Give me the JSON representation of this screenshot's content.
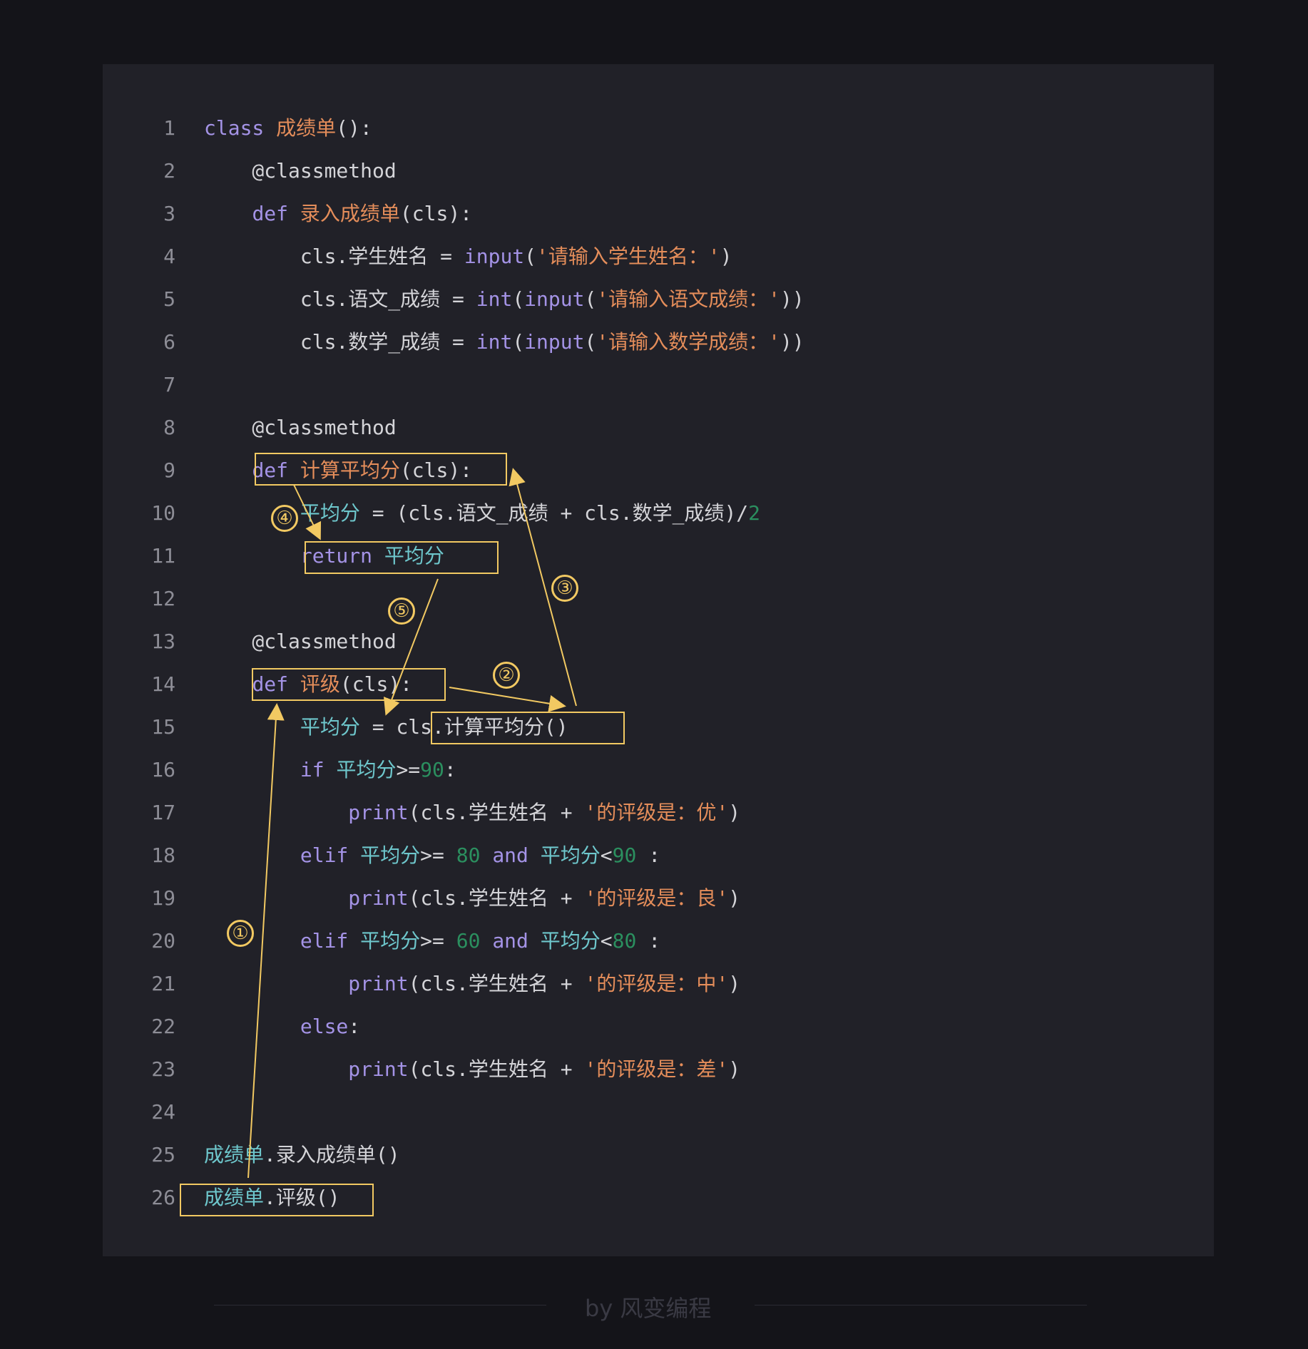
{
  "lines": [
    {
      "n": "1",
      "parts": [
        [
          "kw",
          "class"
        ],
        [
          "dec",
          " "
        ],
        [
          "fn",
          "成绩单"
        ],
        [
          "dec",
          "():"
        ]
      ]
    },
    {
      "n": "2",
      "parts": [
        [
          "dec",
          "    @classmethod"
        ]
      ]
    },
    {
      "n": "3",
      "parts": [
        [
          "dec",
          "    "
        ],
        [
          "kw",
          "def"
        ],
        [
          "dec",
          " "
        ],
        [
          "fn",
          "录入成绩单"
        ],
        [
          "dec",
          "(cls):"
        ]
      ]
    },
    {
      "n": "4",
      "parts": [
        [
          "dec",
          "        cls.学生姓名 = "
        ],
        [
          "kw",
          "input"
        ],
        [
          "dec",
          "("
        ],
        [
          "str",
          "'请输入学生姓名：'"
        ],
        [
          "dec",
          ")"
        ]
      ]
    },
    {
      "n": "5",
      "parts": [
        [
          "dec",
          "        cls.语文_成绩 = "
        ],
        [
          "kw",
          "int"
        ],
        [
          "dec",
          "("
        ],
        [
          "kw",
          "input"
        ],
        [
          "dec",
          "("
        ],
        [
          "str",
          "'请输入语文成绩：'"
        ],
        [
          "dec",
          "))"
        ]
      ]
    },
    {
      "n": "6",
      "parts": [
        [
          "dec",
          "        cls.数学_成绩 = "
        ],
        [
          "kw",
          "int"
        ],
        [
          "dec",
          "("
        ],
        [
          "kw",
          "input"
        ],
        [
          "dec",
          "("
        ],
        [
          "str",
          "'请输入数学成绩：'"
        ],
        [
          "dec",
          "))"
        ]
      ]
    },
    {
      "n": "7",
      "parts": []
    },
    {
      "n": "8",
      "parts": [
        [
          "dec",
          "    @classmethod"
        ]
      ]
    },
    {
      "n": "9",
      "parts": [
        [
          "dec",
          "    "
        ],
        [
          "kw",
          "def"
        ],
        [
          "dec",
          " "
        ],
        [
          "fn",
          "计算平均分"
        ],
        [
          "dec",
          "(cls):"
        ]
      ]
    },
    {
      "n": "10",
      "parts": [
        [
          "dec",
          "        "
        ],
        [
          "var",
          "平均分"
        ],
        [
          "dec",
          " = (cls.语文_成绩 + cls.数学_成绩)/"
        ],
        [
          "num",
          "2"
        ]
      ]
    },
    {
      "n": "11",
      "parts": [
        [
          "dec",
          "        "
        ],
        [
          "kw",
          "return"
        ],
        [
          "dec",
          " "
        ],
        [
          "var",
          "平均分"
        ]
      ]
    },
    {
      "n": "12",
      "parts": []
    },
    {
      "n": "13",
      "parts": [
        [
          "dec",
          "    @classmethod"
        ]
      ]
    },
    {
      "n": "14",
      "parts": [
        [
          "dec",
          "    "
        ],
        [
          "kw",
          "def"
        ],
        [
          "dec",
          " "
        ],
        [
          "fn",
          "评级"
        ],
        [
          "dec",
          "(cls):"
        ]
      ]
    },
    {
      "n": "15",
      "parts": [
        [
          "dec",
          "        "
        ],
        [
          "var",
          "平均分"
        ],
        [
          "dec",
          " = cls.计算平均分()"
        ]
      ]
    },
    {
      "n": "16",
      "parts": [
        [
          "dec",
          "        "
        ],
        [
          "kw",
          "if"
        ],
        [
          "dec",
          " "
        ],
        [
          "var",
          "平均分"
        ],
        [
          "dec",
          ">="
        ],
        [
          "num",
          "90"
        ],
        [
          "dec",
          ":"
        ]
      ]
    },
    {
      "n": "17",
      "parts": [
        [
          "dec",
          "            "
        ],
        [
          "kw",
          "print"
        ],
        [
          "dec",
          "(cls.学生姓名 + "
        ],
        [
          "str",
          "'的评级是：优'"
        ],
        [
          "dec",
          ")"
        ]
      ]
    },
    {
      "n": "18",
      "parts": [
        [
          "dec",
          "        "
        ],
        [
          "kw",
          "elif"
        ],
        [
          "dec",
          " "
        ],
        [
          "var",
          "平均分"
        ],
        [
          "dec",
          ">= "
        ],
        [
          "num",
          "80"
        ],
        [
          "dec",
          " "
        ],
        [
          "kw",
          "and"
        ],
        [
          "dec",
          " "
        ],
        [
          "var",
          "平均分"
        ],
        [
          "dec",
          "<"
        ],
        [
          "num",
          "90"
        ],
        [
          "dec",
          " :"
        ]
      ]
    },
    {
      "n": "19",
      "parts": [
        [
          "dec",
          "            "
        ],
        [
          "kw",
          "print"
        ],
        [
          "dec",
          "(cls.学生姓名 + "
        ],
        [
          "str",
          "'的评级是：良'"
        ],
        [
          "dec",
          ")"
        ]
      ]
    },
    {
      "n": "20",
      "parts": [
        [
          "dec",
          "        "
        ],
        [
          "kw",
          "elif"
        ],
        [
          "dec",
          " "
        ],
        [
          "var",
          "平均分"
        ],
        [
          "dec",
          ">= "
        ],
        [
          "num",
          "60"
        ],
        [
          "dec",
          " "
        ],
        [
          "kw",
          "and"
        ],
        [
          "dec",
          " "
        ],
        [
          "var",
          "平均分"
        ],
        [
          "dec",
          "<"
        ],
        [
          "num",
          "80"
        ],
        [
          "dec",
          " :"
        ]
      ]
    },
    {
      "n": "21",
      "parts": [
        [
          "dec",
          "            "
        ],
        [
          "kw",
          "print"
        ],
        [
          "dec",
          "(cls.学生姓名 + "
        ],
        [
          "str",
          "'的评级是：中'"
        ],
        [
          "dec",
          ")"
        ]
      ]
    },
    {
      "n": "22",
      "parts": [
        [
          "dec",
          "        "
        ],
        [
          "kw",
          "else"
        ],
        [
          "dec",
          ":"
        ]
      ]
    },
    {
      "n": "23",
      "parts": [
        [
          "dec",
          "            "
        ],
        [
          "kw",
          "print"
        ],
        [
          "dec",
          "(cls.学生姓名 + "
        ],
        [
          "str",
          "'的评级是：差'"
        ],
        [
          "dec",
          ")"
        ]
      ]
    },
    {
      "n": "24",
      "parts": []
    },
    {
      "n": "25",
      "parts": [
        [
          "var",
          "成绩单"
        ],
        [
          "dec",
          ".录入成绩单()"
        ]
      ]
    },
    {
      "n": "26",
      "parts": [
        [
          "var",
          "成绩单"
        ],
        [
          "dec",
          ".评级()"
        ]
      ]
    }
  ],
  "steps": [
    "①",
    "②",
    "③",
    "④",
    "⑤"
  ],
  "colors": {
    "annotation": "#f2c962",
    "background": "#212128"
  },
  "footer": "by 风变编程"
}
